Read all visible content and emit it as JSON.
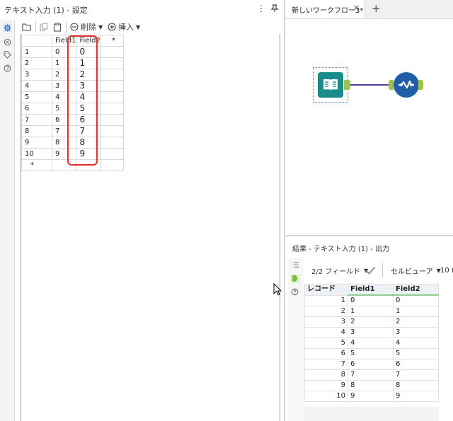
{
  "config_panel": {
    "title": "テキスト入力 (1) - 設定",
    "more_icon": "⋮",
    "pin_icon": "pin-icon",
    "toolbar": {
      "delete_label": "削除",
      "insert_label": "挿入"
    },
    "grid": {
      "headers": [
        "",
        "Field1",
        "Field2",
        "*"
      ],
      "rows": [
        {
          "n": "1",
          "f1": "0",
          "f2": "0"
        },
        {
          "n": "2",
          "f1": "1",
          "f2": "1"
        },
        {
          "n": "3",
          "f1": "2",
          "f2": "2"
        },
        {
          "n": "4",
          "f1": "3",
          "f2": "3"
        },
        {
          "n": "5",
          "f1": "4",
          "f2": "4"
        },
        {
          "n": "6",
          "f1": "5",
          "f2": "5"
        },
        {
          "n": "7",
          "f1": "6",
          "f2": "6"
        },
        {
          "n": "8",
          "f1": "7",
          "f2": "7"
        },
        {
          "n": "9",
          "f1": "8",
          "f2": "8"
        },
        {
          "n": "10",
          "f1": "9",
          "f2": "9"
        }
      ],
      "new_row_marker": "*"
    }
  },
  "workflow": {
    "tab_label": "新しいワークフロー3*",
    "tab_close": "✕",
    "tab_add": "+"
  },
  "results": {
    "title": "結果 - テキスト入力 (1) - 出力",
    "fields_dropdown": "2/2 フィールド",
    "viewer_dropdown": "セルビューア",
    "row_count_partial": "10 (",
    "headers": [
      "レコード",
      "Field1",
      "Field2"
    ],
    "rows": [
      {
        "rec": "1",
        "f1": "0",
        "f2": "0"
      },
      {
        "rec": "2",
        "f1": "1",
        "f2": "1"
      },
      {
        "rec": "3",
        "f1": "2",
        "f2": "2"
      },
      {
        "rec": "4",
        "f1": "3",
        "f2": "3"
      },
      {
        "rec": "5",
        "f1": "4",
        "f2": "4"
      },
      {
        "rec": "6",
        "f1": "5",
        "f2": "5"
      },
      {
        "rec": "7",
        "f1": "6",
        "f2": "6"
      },
      {
        "rec": "8",
        "f1": "7",
        "f2": "7"
      },
      {
        "rec": "9",
        "f1": "8",
        "f2": "8"
      },
      {
        "rec": "10",
        "f1": "9",
        "f2": "9"
      }
    ]
  },
  "colors": {
    "highlight": "#e2312f",
    "text_input_tool": "#1b8c8c",
    "browse_tool": "#1f5da7",
    "anchor": "#9dc34a",
    "connection": "#4c3da3"
  }
}
